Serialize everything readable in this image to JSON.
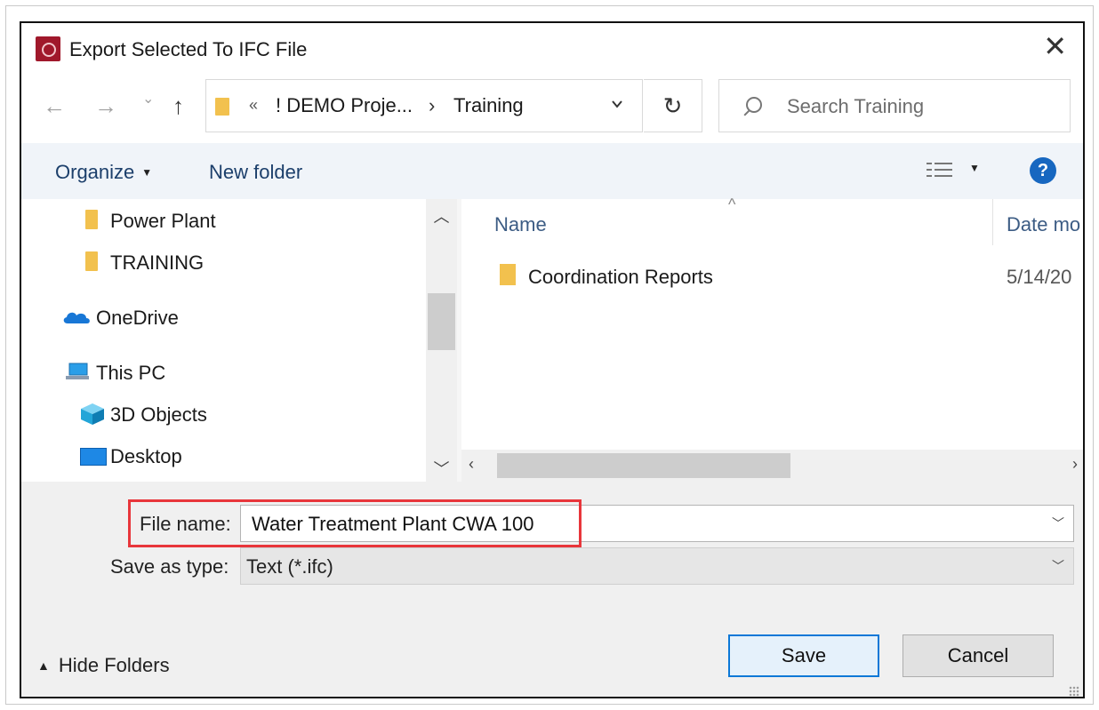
{
  "window": {
    "title": "Export Selected To IFC File",
    "close_glyph": "✕"
  },
  "address": {
    "overflow_glyph": "«",
    "path": [
      "! DEMO Proje...",
      "Training"
    ],
    "separator": "›",
    "refresh_glyph": "↻"
  },
  "nav_buttons": {
    "back": "←",
    "forward": "→",
    "recent": "⌄",
    "up": "↑"
  },
  "search": {
    "placeholder": "Search Training"
  },
  "toolbar": {
    "organize": "Organize",
    "new_folder": "New folder",
    "help": "?"
  },
  "nav_pane": {
    "items": [
      {
        "label": "Power Plant",
        "icon": "folder-icon"
      },
      {
        "label": "TRAINING",
        "icon": "folder-icon"
      },
      {
        "label": "OneDrive",
        "icon": "onedrive-cloud-icon"
      },
      {
        "label": "This PC",
        "icon": "computer-icon"
      },
      {
        "label": "3D Objects",
        "icon": "3d-objects-icon"
      },
      {
        "label": "Desktop",
        "icon": "desktop-icon"
      }
    ]
  },
  "file_list": {
    "columns": [
      "Name",
      "Date mo"
    ],
    "rows": [
      {
        "name": "Coordination Reports",
        "date": "5/14/20"
      }
    ]
  },
  "form": {
    "file_name_label": "File name:",
    "file_name_value": "Water Treatment Plant CWA 100",
    "save_type_label": "Save as type:",
    "save_type_value": "Text (*.ifc)"
  },
  "footer": {
    "hide_folders": "Hide Folders",
    "save": "Save",
    "cancel": "Cancel"
  },
  "colors": {
    "highlight": "#e8363b",
    "accent": "#0b78d7",
    "app_icon": "#a0182b",
    "folder": "#f2c14e"
  }
}
